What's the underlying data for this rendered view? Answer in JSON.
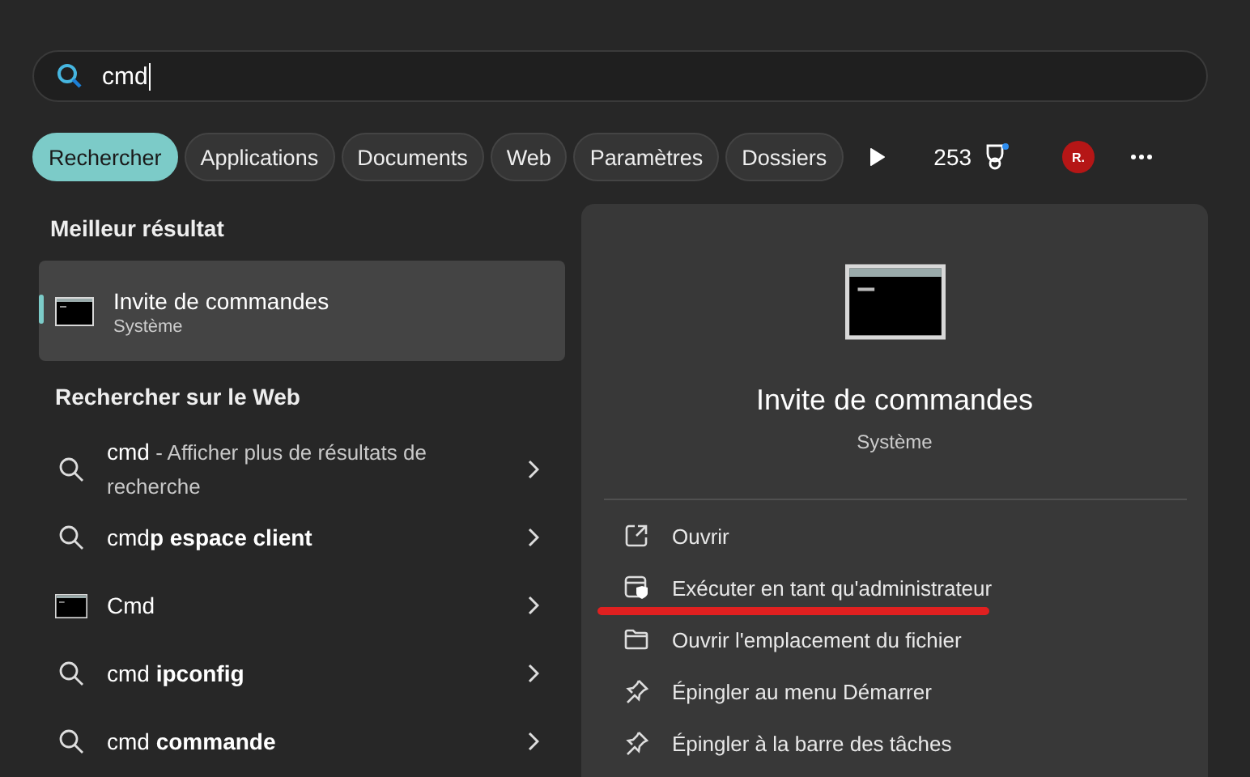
{
  "search": {
    "value": "cmd"
  },
  "filters": [
    {
      "label": "Rechercher",
      "selected": true
    },
    {
      "label": "Applications",
      "selected": false
    },
    {
      "label": "Documents",
      "selected": false
    },
    {
      "label": "Web",
      "selected": false
    },
    {
      "label": "Paramètres",
      "selected": false
    },
    {
      "label": "Dossiers",
      "selected": false
    }
  ],
  "points": "253",
  "avatar": "R.",
  "best_match": {
    "heading": "Meilleur résultat",
    "title": "Invite de commandes",
    "subtitle": "Système",
    "selected": true
  },
  "web": {
    "heading": "Rechercher sur le Web",
    "items": [
      {
        "kind": "search",
        "text": "cmd",
        "description": "- Afficher plus de résultats de recherche"
      },
      {
        "kind": "search",
        "text": "cmd**p espace client**"
      },
      {
        "kind": "app",
        "text": "Cmd"
      },
      {
        "kind": "search",
        "text": "cmd **ipconfig**"
      },
      {
        "kind": "search",
        "text": "cmd **commande**"
      }
    ]
  },
  "detail": {
    "title": "Invite de commandes",
    "subtitle": "Système",
    "actions": [
      {
        "kind": "open",
        "label": "Ouvrir",
        "underlined": false
      },
      {
        "kind": "admin",
        "label": "Exécuter en tant qu'administrateur",
        "underlined": true
      },
      {
        "kind": "folder",
        "label": "Ouvrir l'emplacement du fichier",
        "underlined": false
      },
      {
        "kind": "pin",
        "label": "Épingler au menu Démarrer",
        "underlined": false
      },
      {
        "kind": "pin",
        "label": "Épingler à la barre des tâches",
        "underlined": false
      }
    ]
  }
}
